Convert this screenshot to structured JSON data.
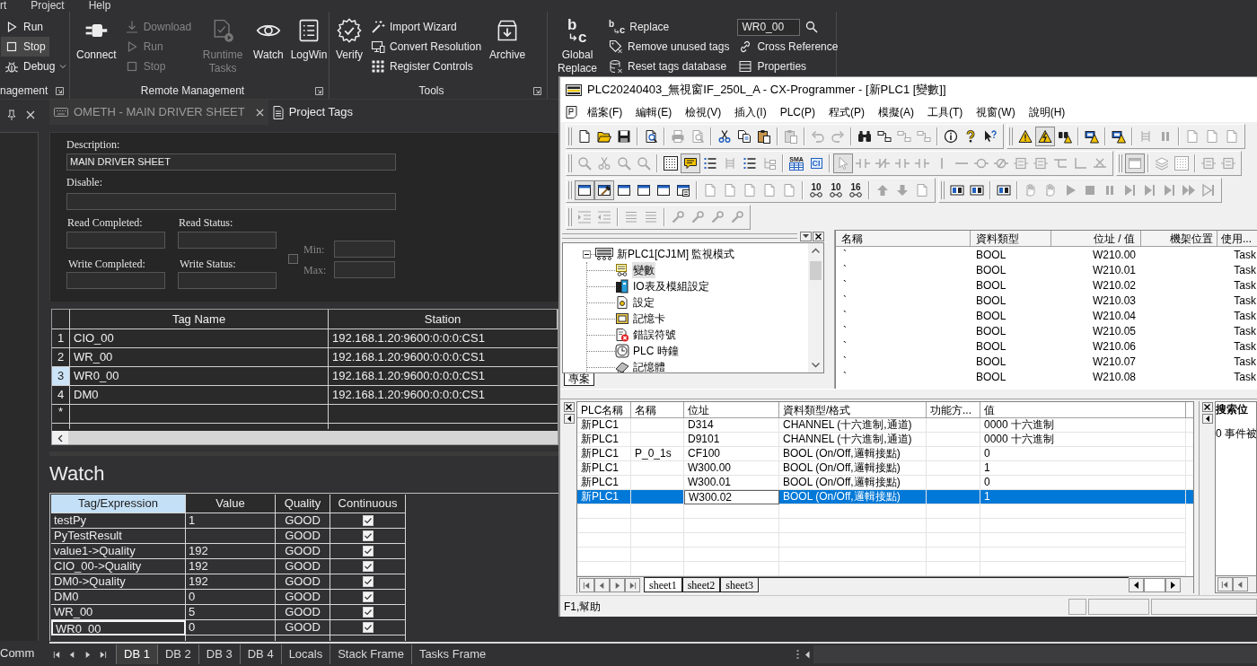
{
  "app_menu": [
    {
      "label": "rt"
    },
    {
      "label": "Project"
    },
    {
      "label": "Help"
    }
  ],
  "ribbon": [
    {
      "label": "nagement",
      "launcher": true,
      "buttons": [
        {
          "kind": "small",
          "label": "Run",
          "disabled": false,
          "selected": false
        },
        {
          "kind": "small",
          "label": "Stop",
          "disabled": false,
          "selected": true
        },
        {
          "kind": "menu",
          "label": "Debug",
          "disabled": false,
          "selected": false
        }
      ]
    },
    {
      "label": "Remote Management",
      "launcher": true,
      "buttons": [
        {
          "kind": "large",
          "label": "Connect",
          "disabled": false,
          "selected": false
        },
        {
          "kind": "small",
          "label": "Download",
          "disabled": true,
          "selected": false
        },
        {
          "kind": "small",
          "label": "Run",
          "disabled": true,
          "selected": false
        },
        {
          "kind": "small",
          "label": "Stop",
          "disabled": true,
          "selected": false
        },
        {
          "kind": "large",
          "label": "Runtime Tasks",
          "disabled": true,
          "selected": false
        },
        {
          "kind": "large",
          "label": "Watch",
          "disabled": false,
          "selected": false
        },
        {
          "kind": "large",
          "label": "LogWin",
          "disabled": false,
          "selected": false
        }
      ]
    },
    {
      "label": "Tools",
      "launcher": true,
      "buttons": [
        {
          "kind": "large",
          "label": "Verify",
          "disabled": false,
          "selected": false
        },
        {
          "kind": "small",
          "label": "Import Wizard",
          "disabled": false,
          "selected": false
        },
        {
          "kind": "small",
          "label": "Convert Resolution",
          "disabled": false,
          "selected": false
        },
        {
          "kind": "small",
          "label": "Register Controls",
          "disabled": false,
          "selected": false
        },
        {
          "kind": "large",
          "label": "Archive",
          "disabled": false,
          "selected": false
        }
      ]
    },
    {
      "buttons": [
        {
          "kind": "large",
          "label": "Global Replace",
          "glyphs": [
            "b",
            "c"
          ],
          "disabled": false,
          "selected": false
        },
        {
          "kind": "small",
          "label": "Replace",
          "glyphs": [
            "b",
            "c"
          ],
          "disabled": false,
          "selected": false
        },
        {
          "kind": "small",
          "label": "Remove unused tags",
          "disabled": false,
          "selected": false
        },
        {
          "kind": "small",
          "label": "Reset tags database",
          "disabled": false,
          "selected": false
        },
        {
          "kind": "search",
          "value": "WR0_00",
          "disabled": false,
          "selected": false
        },
        {
          "kind": "small",
          "label": "Cross Reference",
          "disabled": false,
          "selected": false
        },
        {
          "kind": "small",
          "label": "Properties",
          "disabled": false,
          "selected": false
        }
      ]
    }
  ],
  "documents": [
    {
      "label": "OMETH - MAIN DRIVER SHEET",
      "selected": true
    },
    {
      "label": "Project Tags",
      "selected": false
    }
  ],
  "driver_sheet": {
    "description": {
      "label": "Description:",
      "value": "MAIN DRIVER SHEET"
    },
    "disable": {
      "label": "Disable:"
    },
    "status_fields": [
      {
        "label": "Read Completed:"
      },
      {
        "label": "Read Status:"
      },
      {
        "label": "Write Completed:"
      },
      {
        "label": "Write Status:"
      }
    ],
    "range": {
      "checked": false,
      "fields": [
        {
          "label": "Min:"
        },
        {
          "label": "Max:"
        }
      ]
    }
  },
  "tag_table": {
    "columns": [
      {
        "label": "Tag Name"
      },
      {
        "label": "Station"
      }
    ],
    "rows": [
      {
        "number": "1",
        "tag_name": "CIO_00",
        "station": "192.168.1.20:9600:0:0:0:CS1",
        "selected": false
      },
      {
        "number": "2",
        "tag_name": "WR_00",
        "station": "192.168.1.20:9600:0:0:0:CS1",
        "selected": false
      },
      {
        "number": "3",
        "tag_name": "WR0_00",
        "station": "192.168.1.20:9600:0:0:0:CS1",
        "selected": true
      },
      {
        "number": "4",
        "tag_name": "DM0",
        "station": "192.168.1.20:9600:0:0:0:CS1",
        "selected": false
      }
    ],
    "new_row_marker": "*"
  },
  "watch": {
    "title": "Watch",
    "columns": [
      {
        "label": "Tag/Expression",
        "selected": true
      },
      {
        "label": "Value",
        "selected": false
      },
      {
        "label": "Quality",
        "selected": false
      },
      {
        "label": "Continuous",
        "selected": false
      }
    ],
    "rows": [
      {
        "tag": "testPy",
        "value": "1",
        "quality": "GOOD",
        "continuous": true,
        "selected": false
      },
      {
        "tag": "PyTestResult",
        "quality": "GOOD",
        "continuous": true,
        "selected": false
      },
      {
        "tag": "value1->Quality",
        "value": "192",
        "quality": "GOOD",
        "continuous": true,
        "selected": false
      },
      {
        "tag": "CIO_00->Quality",
        "value": "192",
        "quality": "GOOD",
        "continuous": true,
        "selected": false
      },
      {
        "tag": "DM0->Quality",
        "value": "192",
        "quality": "GOOD",
        "continuous": true,
        "selected": false
      },
      {
        "tag": "DM0",
        "value": "0",
        "quality": "GOOD",
        "continuous": true,
        "selected": false
      },
      {
        "tag": "WR_00",
        "value": "5",
        "quality": "GOOD",
        "continuous": true,
        "selected": false
      },
      {
        "tag": "WR0_00",
        "value": "0",
        "quality": "GOOD",
        "continuous": true,
        "selected": true
      }
    ]
  },
  "bottom_bar": {
    "panel_tab": "Comm",
    "tabs": [
      {
        "label": "DB 1",
        "selected": true
      },
      {
        "label": "DB 2",
        "selected": false
      },
      {
        "label": "DB 3",
        "selected": false
      },
      {
        "label": "DB 4",
        "selected": false
      },
      {
        "label": "Locals",
        "selected": false
      },
      {
        "label": "Stack Frame",
        "selected": false
      },
      {
        "label": "Tasks Frame",
        "selected": false
      }
    ]
  },
  "cx_programmer": {
    "title": "PLC20240403_無視窗IF_250L_A - CX-Programmer - [新PLC1 [變數]]",
    "menu": [
      {
        "label": "檔案(F)"
      },
      {
        "label": "編輯(E)"
      },
      {
        "label": "檢視(V)"
      },
      {
        "label": "插入(I)"
      },
      {
        "label": "PLC(P)"
      },
      {
        "label": "程式(P)"
      },
      {
        "label": "模擬(A)"
      },
      {
        "label": "工具(T)"
      },
      {
        "label": "視窗(W)"
      },
      {
        "label": "說明(H)"
      }
    ],
    "toolbar_rows": [
      {
        "toolbars": [
          {
            "groups": [
              {
                "buttons": [
                  {
                    "disabled": false,
                    "pressed": false
                  },
                  {
                    "disabled": false,
                    "pressed": false
                  },
                  {
                    "disabled": false,
                    "pressed": false
                  }
                ]
              },
              {
                "buttons": [
                  {
                    "disabled": false,
                    "pressed": false
                  }
                ]
              },
              {
                "buttons": [
                  {
                    "disabled": true,
                    "pressed": false
                  },
                  {
                    "disabled": true,
                    "pressed": false
                  }
                ]
              },
              {
                "buttons": [
                  {
                    "disabled": false,
                    "pressed": false
                  },
                  {
                    "disabled": false,
                    "pressed": false
                  },
                  {
                    "disabled": false,
                    "pressed": false
                  }
                ]
              },
              {
                "buttons": [
                  {
                    "disabled": true,
                    "pressed": false
                  }
                ]
              },
              {
                "buttons": [
                  {
                    "disabled": true,
                    "pressed": false
                  },
                  {
                    "disabled": true,
                    "pressed": false
                  }
                ]
              },
              {
                "buttons": [
                  {
                    "disabled": false,
                    "pressed": false
                  },
                  {
                    "disabled": false,
                    "pressed": false
                  },
                  {
                    "disabled": true,
                    "pressed": false
                  },
                  {
                    "disabled": true,
                    "pressed": false
                  }
                ]
              },
              {
                "buttons": [
                  {
                    "disabled": false,
                    "pressed": false
                  },
                  {
                    "disabled": false,
                    "pressed": false
                  },
                  {
                    "disabled": false,
                    "pressed": false
                  }
                ]
              }
            ]
          },
          {
            "groups": [
              {
                "buttons": [
                  {
                    "disabled": false,
                    "pressed": false
                  },
                  {
                    "disabled": false,
                    "pressed": true
                  },
                  {
                    "disabled": false,
                    "pressed": false
                  }
                ]
              },
              {
                "buttons": [
                  {
                    "disabled": false,
                    "pressed": false
                  }
                ]
              },
              {
                "buttons": [
                  {
                    "disabled": false,
                    "pressed": false
                  }
                ]
              },
              {
                "buttons": [
                  {
                    "disabled": true,
                    "pressed": false
                  },
                  {
                    "disabled": true,
                    "pressed": false
                  }
                ]
              },
              {
                "buttons": [
                  {
                    "disabled": true,
                    "pressed": false
                  },
                  {
                    "disabled": true,
                    "pressed": false
                  },
                  {
                    "disabled": true,
                    "pressed": false
                  }
                ]
              }
            ]
          }
        ]
      },
      {
        "toolbars": [
          {
            "groups": [
              {
                "buttons": [
                  {
                    "disabled": true,
                    "pressed": false
                  },
                  {
                    "disabled": true,
                    "pressed": false
                  },
                  {
                    "disabled": true,
                    "pressed": false
                  },
                  {
                    "disabled": true,
                    "pressed": false
                  }
                ]
              },
              {
                "buttons": [
                  {
                    "disabled": false,
                    "pressed": false
                  },
                  {
                    "disabled": false,
                    "pressed": true
                  },
                  {
                    "disabled": false,
                    "pressed": false
                  },
                  {
                    "disabled": true,
                    "pressed": false
                  },
                  {
                    "disabled": false,
                    "pressed": false
                  },
                  {
                    "disabled": true,
                    "pressed": false
                  }
                ]
              },
              {
                "buttons": [
                  {
                    "label": "SMA",
                    "disabled": false,
                    "pressed": false
                  },
                  {
                    "label": "CI",
                    "disabled": false,
                    "pressed": false
                  }
                ]
              },
              {
                "buttons": [
                  {
                    "disabled": true,
                    "pressed": true
                  },
                  {
                    "disabled": true,
                    "pressed": false
                  },
                  {
                    "disabled": true,
                    "pressed": false
                  },
                  {
                    "disabled": true,
                    "pressed": false
                  },
                  {
                    "disabled": true,
                    "pressed": false
                  },
                  {
                    "disabled": true,
                    "pressed": false
                  },
                  {
                    "disabled": true,
                    "pressed": false
                  },
                  {
                    "disabled": true,
                    "pressed": false
                  },
                  {
                    "disabled": true,
                    "pressed": false
                  },
                  {
                    "disabled": true,
                    "pressed": false
                  },
                  {
                    "disabled": true,
                    "pressed": false
                  },
                  {
                    "disabled": true,
                    "pressed": false
                  },
                  {
                    "disabled": true,
                    "pressed": false
                  },
                  {
                    "disabled": true,
                    "pressed": false
                  }
                ]
              }
            ]
          },
          {
            "groups": [
              {
                "buttons": [
                  {
                    "disabled": true,
                    "pressed": true
                  }
                ]
              },
              {
                "buttons": [
                  {
                    "disabled": true,
                    "pressed": false
                  },
                  {
                    "disabled": true,
                    "pressed": false
                  }
                ]
              },
              {
                "buttons": [
                  {
                    "disabled": true,
                    "pressed": false
                  },
                  {
                    "disabled": true,
                    "pressed": false
                  }
                ]
              }
            ]
          }
        ]
      },
      {
        "toolbars": [
          {
            "groups": [
              {
                "buttons": [
                  {
                    "disabled": false,
                    "pressed": true
                  },
                  {
                    "disabled": false,
                    "pressed": true
                  },
                  {
                    "disabled": false,
                    "pressed": false
                  },
                  {
                    "disabled": false,
                    "pressed": false
                  },
                  {
                    "disabled": false,
                    "pressed": false
                  },
                  {
                    "disabled": false,
                    "pressed": false
                  }
                ]
              },
              {
                "buttons": [
                  {
                    "disabled": true,
                    "pressed": false
                  },
                  {
                    "disabled": true,
                    "pressed": false
                  },
                  {
                    "disabled": true,
                    "pressed": false
                  },
                  {
                    "disabled": true,
                    "pressed": false
                  },
                  {
                    "disabled": true,
                    "pressed": false
                  }
                ]
              },
              {
                "buttons": [
                  {
                    "label": "10",
                    "disabled": false,
                    "pressed": false
                  },
                  {
                    "label": "10",
                    "disabled": false,
                    "pressed": false
                  },
                  {
                    "label": "16",
                    "disabled": false,
                    "pressed": false
                  }
                ]
              },
              {
                "buttons": [
                  {
                    "disabled": true,
                    "pressed": false
                  },
                  {
                    "disabled": true,
                    "pressed": false
                  },
                  {
                    "disabled": true,
                    "pressed": false
                  }
                ]
              }
            ]
          },
          {
            "groups": [
              {
                "buttons": [
                  {
                    "disabled": false,
                    "pressed": false
                  },
                  {
                    "disabled": false,
                    "pressed": false
                  }
                ]
              },
              {
                "buttons": [
                  {
                    "disabled": false,
                    "pressed": false
                  }
                ]
              },
              {
                "buttons": [
                  {
                    "disabled": true,
                    "pressed": false
                  },
                  {
                    "disabled": true,
                    "pressed": false
                  },
                  {
                    "disabled": true,
                    "pressed": false
                  },
                  {
                    "disabled": true,
                    "pressed": false
                  },
                  {
                    "disabled": true,
                    "pressed": false
                  },
                  {
                    "disabled": true,
                    "pressed": false
                  },
                  {
                    "disabled": true,
                    "pressed": false
                  },
                  {
                    "disabled": true,
                    "pressed": false
                  },
                  {
                    "disabled": true,
                    "pressed": false
                  },
                  {
                    "disabled": true,
                    "pressed": false
                  }
                ]
              }
            ]
          }
        ]
      },
      {
        "toolbars": [
          {
            "groups": [
              {
                "buttons": [
                  {
                    "disabled": true,
                    "pressed": false
                  },
                  {
                    "disabled": true,
                    "pressed": false
                  }
                ]
              },
              {
                "buttons": [
                  {
                    "disabled": true,
                    "pressed": false
                  },
                  {
                    "disabled": true,
                    "pressed": false
                  }
                ]
              },
              {
                "buttons": [
                  {
                    "disabled": true,
                    "pressed": false
                  },
                  {
                    "disabled": true,
                    "pressed": false
                  },
                  {
                    "disabled": true,
                    "pressed": false
                  },
                  {
                    "disabled": true,
                    "pressed": false
                  }
                ]
              }
            ]
          }
        ]
      }
    ],
    "project_tree": {
      "label": "新PLC1[CJ1M] 監視模式",
      "expanded": true,
      "selected": false,
      "children": [
        {
          "label": "變數",
          "selected": true
        },
        {
          "label": "IO表及模組設定",
          "selected": false
        },
        {
          "label": "設定",
          "selected": false
        },
        {
          "label": "記憶卡",
          "selected": false
        },
        {
          "label": "錯誤符號",
          "selected": false
        },
        {
          "label": "PLC 時鐘",
          "selected": false
        },
        {
          "label": "記憶體",
          "selected": false
        }
      ],
      "tab": "專案"
    },
    "variables": {
      "columns": [
        {
          "label": "名稱"
        },
        {
          "label": "資料類型"
        },
        {
          "label": "位址 / 值"
        },
        {
          "label": "機架位置"
        },
        {
          "label": "使用..."
        }
      ],
      "rows": [
        {
          "name": "`",
          "data_type": "BOOL",
          "address": "W210.00",
          "usage": "Task"
        },
        {
          "name": "`",
          "data_type": "BOOL",
          "address": "W210.01",
          "usage": "Task"
        },
        {
          "name": "`",
          "data_type": "BOOL",
          "address": "W210.02",
          "usage": "Task"
        },
        {
          "name": "`",
          "data_type": "BOOL",
          "address": "W210.03",
          "usage": "Task"
        },
        {
          "name": "`",
          "data_type": "BOOL",
          "address": "W210.04",
          "usage": "Task"
        },
        {
          "name": "`",
          "data_type": "BOOL",
          "address": "W210.05",
          "usage": "Task"
        },
        {
          "name": "`",
          "data_type": "BOOL",
          "address": "W210.06",
          "usage": "Task"
        },
        {
          "name": "`",
          "data_type": "BOOL",
          "address": "W210.07",
          "usage": "Task"
        },
        {
          "name": "`",
          "data_type": "BOOL",
          "address": "W210.08",
          "usage": "Task"
        }
      ]
    },
    "watch_window": {
      "columns": [
        {
          "label": "PLC名稱"
        },
        {
          "label": "名稱"
        },
        {
          "label": "位址"
        },
        {
          "label": "資料類型/格式"
        },
        {
          "label": "功能方..."
        },
        {
          "label": "值"
        }
      ],
      "rows": [
        {
          "plc": "新PLC1",
          "address": "D314",
          "format": "CHANNEL (十六進制,通道)",
          "value": "0000 十六進制",
          "selected": false,
          "editing": false
        },
        {
          "plc": "新PLC1",
          "address": "D9101",
          "format": "CHANNEL (十六進制,通道)",
          "value": "0000 十六進制",
          "selected": false,
          "editing": false
        },
        {
          "plc": "新PLC1",
          "name": "P_0_1s",
          "address": "CF100",
          "format": "BOOL (On/Off,邏輯接點)",
          "value": "0",
          "selected": false,
          "editing": false
        },
        {
          "plc": "新PLC1",
          "address": "W300.00",
          "format": "BOOL (On/Off,邏輯接點)",
          "value": "1",
          "selected": false,
          "editing": false
        },
        {
          "plc": "新PLC1",
          "address": "W300.01",
          "format": "BOOL (On/Off,邏輯接點)",
          "value": "0",
          "selected": false,
          "editing": false
        },
        {
          "plc": "新PLC1",
          "address": "W300.02",
          "format": "BOOL (On/Off,邏輯接點)",
          "value": "1",
          "selected": true,
          "editing": true
        }
      ],
      "sheets": [
        {
          "label": "sheet1",
          "selected": true
        },
        {
          "label": "sheet2",
          "selected": false
        },
        {
          "label": "sheet3",
          "selected": false
        }
      ]
    },
    "search_pane": {
      "title": "搜索位",
      "message": "0 事件被"
    },
    "status_bar": {
      "text": "F1,幫助"
    }
  }
}
